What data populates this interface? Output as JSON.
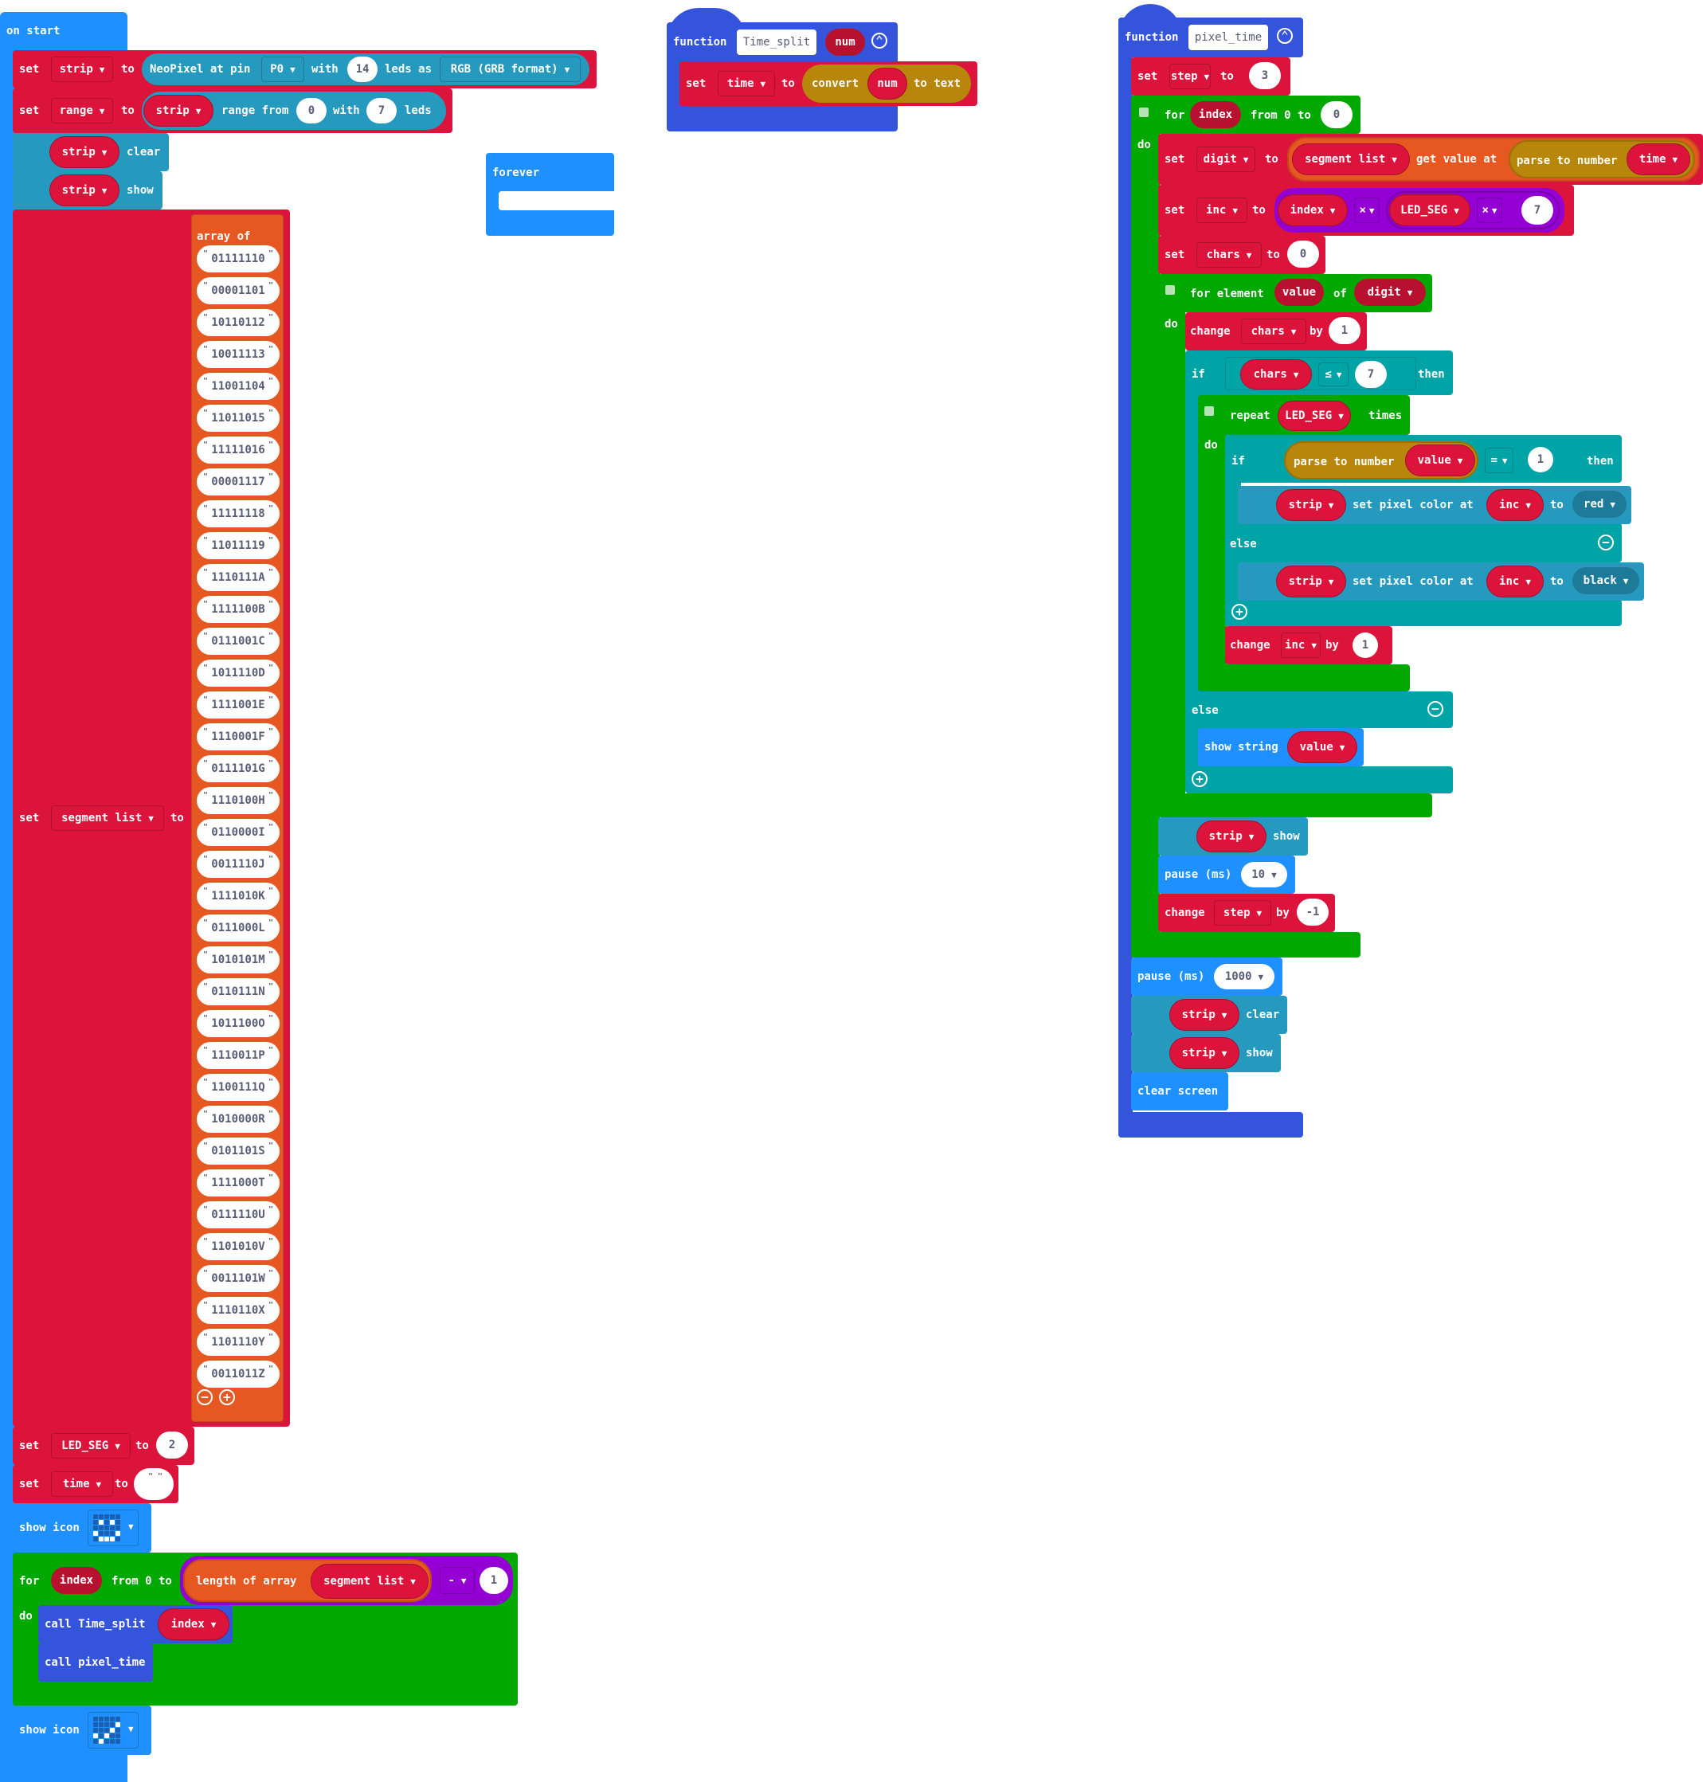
{
  "on_start": {
    "hat": "on start",
    "set_strip": {
      "set": "set",
      "var": "strip",
      "to": "to",
      "neopixel": "NeoPixel at pin",
      "pin": "P0",
      "with": "with",
      "count": "14",
      "leds_as": "leds as",
      "mode": "RGB (GRB format)"
    },
    "set_range": {
      "set": "set",
      "var": "range",
      "to": "to",
      "strip": "strip",
      "range_from": "range from",
      "from": "0",
      "with": "with",
      "count": "7",
      "leds": "leds"
    },
    "strip_clear": {
      "strip": "strip",
      "action": "clear"
    },
    "strip_show": {
      "strip": "strip",
      "action": "show"
    },
    "set_segment": {
      "set": "set",
      "var": "segment list",
      "to": "to",
      "array_of": "array of",
      "items": [
        "01111110",
        "00001101",
        "10110112",
        "10011113",
        "11001104",
        "11011015",
        "11111016",
        "00001117",
        "11111118",
        "11011119",
        "1110111A",
        "1111100B",
        "0111001C",
        "1011110D",
        "1111001E",
        "1110001F",
        "0111101G",
        "1110100H",
        "0110000I",
        "0011110J",
        "1111010K",
        "0111000L",
        "1010101M",
        "0110111N",
        "1011100O",
        "1110011P",
        "1100111Q",
        "1010000R",
        "0101101S",
        "1111000T",
        "0111110U",
        "1101010V",
        "0011101W",
        "1110110X",
        "1101110Y",
        "0011011Z"
      ]
    },
    "set_led_seg": {
      "set": "set",
      "var": "LED_SEG",
      "to": "to",
      "value": "2"
    },
    "set_time": {
      "set": "set",
      "var": "time",
      "to": "to",
      "value": ""
    },
    "show_icon_1": {
      "label": "show icon",
      "icon": "happy-face",
      "leds": [
        [
          0,
          0,
          0,
          0,
          0
        ],
        [
          0,
          1,
          0,
          1,
          0
        ],
        [
          0,
          0,
          0,
          0,
          0
        ],
        [
          1,
          0,
          0,
          0,
          1
        ],
        [
          0,
          1,
          1,
          1,
          0
        ]
      ]
    },
    "for_loop": {
      "for": "for",
      "var": "index",
      "from_to": "from 0 to",
      "length_of_array": "length of array",
      "array": "segment list",
      "op": "-",
      "operand": "1",
      "do": "do"
    },
    "call_time_split": {
      "label": "call Time_split",
      "arg": "index"
    },
    "call_pixel_time": {
      "label": "call pixel_time"
    },
    "show_icon_2": {
      "label": "show icon",
      "icon": "check-mark",
      "leds": [
        [
          0,
          0,
          0,
          0,
          0
        ],
        [
          0,
          0,
          0,
          0,
          1
        ],
        [
          0,
          0,
          0,
          1,
          0
        ],
        [
          1,
          0,
          1,
          0,
          0
        ],
        [
          0,
          1,
          0,
          0,
          0
        ]
      ]
    }
  },
  "forever": {
    "label": "forever"
  },
  "time_split": {
    "function": "function",
    "name": "Time_split",
    "param": "num",
    "set": "set",
    "var": "time",
    "to": "to",
    "convert": "convert",
    "arg": "num",
    "to_text": "to text"
  },
  "pixel_time": {
    "function": "function",
    "name": "pixel_time",
    "set_step": {
      "set": "set",
      "var": "step",
      "to": "to",
      "value": "3"
    },
    "for": {
      "for": "for",
      "var": "index",
      "from_to": "from 0 to",
      "value": "0",
      "do": "do"
    },
    "set_digit": {
      "set": "set",
      "var": "digit",
      "to": "to",
      "list": "segment list",
      "get_value_at": "get value at",
      "parse": "parse to number",
      "arg": "time"
    },
    "set_inc": {
      "set": "set",
      "var": "inc",
      "to": "to",
      "a": "index",
      "op1": "×",
      "b": "LED_SEG",
      "op2": "×",
      "c": "7"
    },
    "set_chars": {
      "set": "set",
      "var": "chars",
      "to": "to",
      "value": "0"
    },
    "for_element": {
      "label": "for element",
      "var": "value",
      "of": "of",
      "list": "digit",
      "do": "do"
    },
    "change_chars": {
      "change": "change",
      "var": "chars",
      "by": "by",
      "value": "1"
    },
    "if_chars": {
      "if": "if",
      "var": "chars",
      "op": "≤",
      "value": "7",
      "then": "then"
    },
    "repeat": {
      "repeat": "repeat",
      "var": "LED_SEG",
      "times": "times",
      "do": "do"
    },
    "if_value": {
      "if": "if",
      "parse": "parse to number",
      "var": "value",
      "op": "=",
      "value": "1",
      "then": "then"
    },
    "set_red": {
      "strip": "strip",
      "action": "set pixel color at",
      "index": "inc",
      "to": "to",
      "color": "red"
    },
    "else1": "else",
    "set_black": {
      "strip": "strip",
      "action": "set pixel color at",
      "index": "inc",
      "to": "to",
      "color": "black"
    },
    "change_inc": {
      "change": "change",
      "var": "inc",
      "by": "by",
      "value": "1"
    },
    "else2": "else",
    "show_string": {
      "label": "show string",
      "var": "value"
    },
    "strip_show": {
      "strip": "strip",
      "action": "show"
    },
    "pause10": {
      "label": "pause (ms)",
      "value": "10"
    },
    "change_step": {
      "change": "change",
      "var": "step",
      "by": "by",
      "value": "-1"
    },
    "pause1000": {
      "label": "pause (ms)",
      "value": "1000"
    },
    "strip_clear2": {
      "strip": "strip",
      "action": "clear"
    },
    "strip_show2": {
      "strip": "strip",
      "action": "show"
    },
    "clear_screen": "clear screen"
  },
  "colors": {
    "events": "#1e90ff",
    "variables": "#dc143c",
    "neopixel": "#2699bf",
    "loops": "#00a800",
    "logic": "#00a4a6",
    "math": "#9400d3",
    "arrays": "#e65722",
    "text": "#b8860b",
    "functions": "#3455db"
  }
}
